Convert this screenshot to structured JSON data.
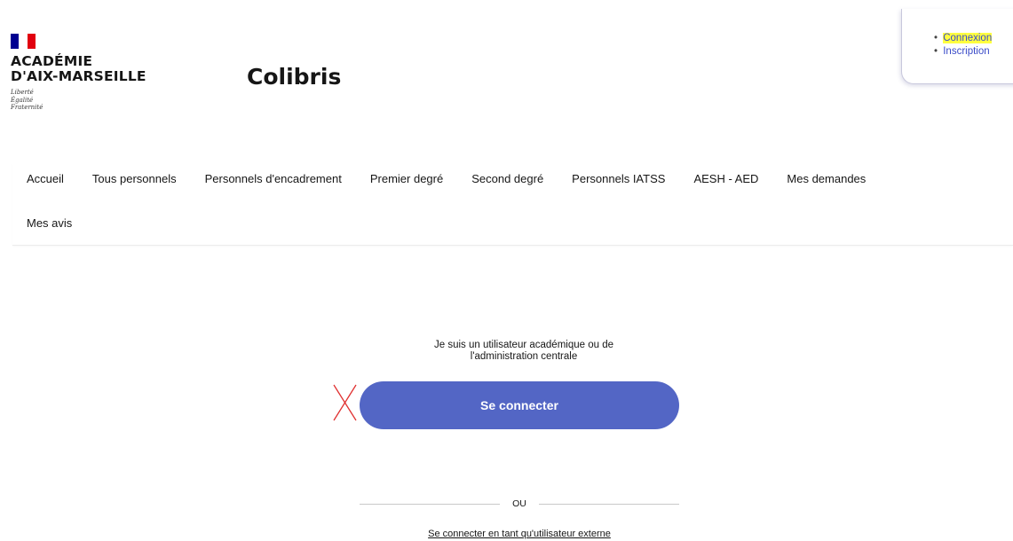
{
  "header": {
    "logo": {
      "title_line1": "ACADÉMIE",
      "title_line2": "D'AIX-MARSEILLE",
      "motto": [
        "Liberté",
        "Égalité",
        "Fraternité"
      ],
      "flag_colors": [
        "#000091",
        "#ffffff",
        "#e1000f"
      ]
    },
    "service_name": "Colibris",
    "account_links": {
      "connexion": "Connexion",
      "inscription": "Inscription"
    }
  },
  "nav": {
    "items": [
      "Accueil",
      "Tous personnels",
      "Personnels d'encadrement",
      "Premier degré",
      "Second degré",
      "Personnels IATSS",
      "AESH - AED",
      "Mes demandes",
      "Mes avis"
    ]
  },
  "main": {
    "intro_line1": "Je suis un utilisateur académique ou de",
    "intro_line2": "l'administration centrale",
    "login_button": "Se connecter",
    "separator": "OU",
    "external_link": "Se connecter en tant qu'utilisateur externe"
  },
  "colors": {
    "primary_button": "#5366c5",
    "link": "#3a4bc8",
    "highlight": "#ffff40",
    "cross_mark": "#e03030"
  }
}
